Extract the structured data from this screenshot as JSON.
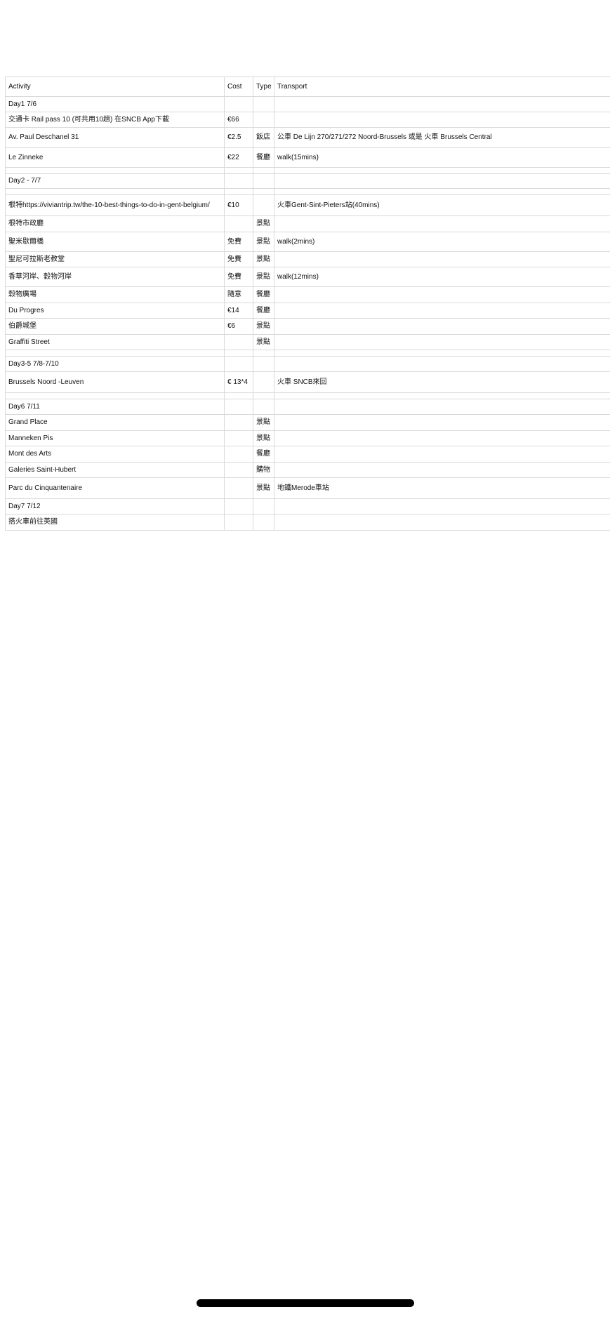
{
  "header": {
    "activity": "Activity",
    "cost": "Cost",
    "type": "Type",
    "transport": "Transport"
  },
  "rows": [
    {
      "activity": "Day1 7/6",
      "cost": "",
      "type": "",
      "transport": ""
    },
    {
      "activity": "交通卡 Rail pass 10 (可共用10趟) 在SNCB App下載",
      "cost": "€66",
      "type": "",
      "transport": ""
    },
    {
      "activity": "Av. Paul Deschanel 31",
      "cost": "€2.5",
      "type": "飯店",
      "transport": "公車 De Lijn 270/271/272 Noord-Brussels 或是 火車 Brussels Central"
    },
    {
      "activity": "Le Zinneke",
      "cost": "€22",
      "type": "餐廳",
      "transport": "walk(15mins)"
    },
    {
      "activity": "",
      "cost": "",
      "type": "",
      "transport": ""
    },
    {
      "activity": "Day2 - 7/7",
      "cost": "",
      "type": "",
      "transport": ""
    },
    {
      "activity": "",
      "cost": "",
      "type": "",
      "transport": ""
    },
    {
      "activity": "根特https://viviantrip.tw/the-10-best-things-to-do-in-gent-belgium/",
      "cost": "€10",
      "type": "",
      "transport": "火車Gent-Sint-Pieters站(40mins)"
    },
    {
      "activity": "根特市政廳",
      "cost": "",
      "type": "景點",
      "transport": ""
    },
    {
      "activity": "聖米歇爾橋",
      "cost": "免費",
      "type": "景點",
      "transport": "walk(2mins)"
    },
    {
      "activity": "聖尼可拉斯老教堂",
      "cost": "免費",
      "type": "景點",
      "transport": ""
    },
    {
      "activity": "香草河岸、穀物河岸",
      "cost": "免費",
      "type": "景點",
      "transport": "walk(12mins)"
    },
    {
      "activity": "穀物廣場",
      "cost": "隨意",
      "type": "餐廳",
      "transport": ""
    },
    {
      "activity": "Du Progres",
      "cost": "€14",
      "type": "餐廳",
      "transport": ""
    },
    {
      "activity": "伯爵城堡",
      "cost": "€6",
      "type": "景點",
      "transport": ""
    },
    {
      "activity": "Graffiti Street",
      "cost": "",
      "type": "景點",
      "transport": ""
    },
    {
      "activity": "",
      "cost": "",
      "type": "",
      "transport": ""
    },
    {
      "activity": "Day3-5 7/8-7/10",
      "cost": "",
      "type": "",
      "transport": ""
    },
    {
      "activity": "Brussels Noord -Leuven",
      "cost": "€ 13*4",
      "type": "",
      "transport": "火車 SNCB來回"
    },
    {
      "activity": "",
      "cost": "",
      "type": "",
      "transport": ""
    },
    {
      "activity": "Day6 7/11",
      "cost": "",
      "type": "",
      "transport": ""
    },
    {
      "activity": "Grand Place",
      "cost": "",
      "type": "景點",
      "transport": ""
    },
    {
      "activity": "Manneken Pis",
      "cost": "",
      "type": "景點",
      "transport": ""
    },
    {
      "activity": "Mont des Arts",
      "cost": "",
      "type": "餐廳",
      "transport": ""
    },
    {
      "activity": "Galeries Saint-Hubert",
      "cost": "",
      "type": "購物",
      "transport": ""
    },
    {
      "activity": "Parc du Cinquantenaire",
      "cost": "",
      "type": "景點",
      "transport": "地鐵Merode車站"
    },
    {
      "activity": "Day7 7/12",
      "cost": "",
      "type": "",
      "transport": ""
    },
    {
      "activity": "搭火車前往英國",
      "cost": "",
      "type": "",
      "transport": ""
    }
  ]
}
